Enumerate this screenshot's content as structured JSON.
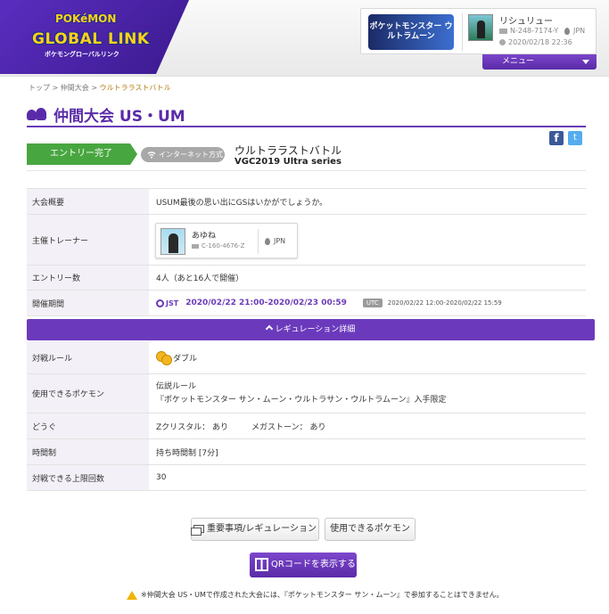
{
  "header": {
    "logo_top": "POKéMON",
    "logo_main": "GLOBAL LINK",
    "logo_sub": "ポケモングローバルリンク",
    "game_logo": "ポケットモンスター ウルトラムーン",
    "user": {
      "name": "リシュリュー",
      "id": "N-248-7174-Y",
      "datetime": "2020/02/18 22:36",
      "location": "JPN"
    },
    "menu_label": "メニュー"
  },
  "breadcrumb": {
    "top": "トップ",
    "competitions": "仲間大会",
    "current": "ウルトララストバトル",
    "sep": ">"
  },
  "page_title": "仲間大会 US・UM",
  "social": {
    "facebook": "f",
    "twitter": "t"
  },
  "competition": {
    "entry_status": "エントリー完了",
    "format_tag": "インターネット方式",
    "name": "ウルトララストバトル",
    "series": "VGC2019 Ultra series"
  },
  "info": {
    "overview_label": "大会概要",
    "overview": "USUM最後の思い出にGSはいかがでしょうか。",
    "host_label": "主催トレーナー",
    "host": {
      "name": "あゆね",
      "id": "C-160-4676-Z",
      "location": "JPN"
    },
    "entries_label": "エントリー数",
    "entries": "4人（あと16人で開催）",
    "period_label": "開催期間",
    "period_jst_tag": "JST",
    "period_jst": "2020/02/22 21:00-2020/02/23 00:59",
    "period_utc_tag": "UTC",
    "period_utc": "2020/02/22 12:00-2020/02/22 15:59"
  },
  "regulation": {
    "bar_label": "レギュレーション詳細",
    "battle_rule_label": "対戦ルール",
    "battle_rule": "ダブル",
    "pokemon_label": "使用できるポケモン",
    "pokemon_line1": "伝説ルール",
    "pokemon_line2": "『ポケットモンスター サン・ムーン・ウルトラサン・ウルトラムーン』入手限定",
    "items_label": "どうぐ",
    "z_crystal": "Zクリスタル： あり",
    "mega_stone": "メガストーン： あり",
    "time_label": "時間制",
    "time": "持ち時間制 [7分]",
    "limit_label": "対戦できる上限回数",
    "limit": "30"
  },
  "buttons": {
    "important": "重要事項/レギュレーション",
    "usable_pokemon": "使用できるポケモン",
    "qr": "QRコードを表示する"
  },
  "footer_note": "※仲間大会 US・UMで作成された大会には、『ポケットモンスター サン・ムーン』で参加することはできません。"
}
